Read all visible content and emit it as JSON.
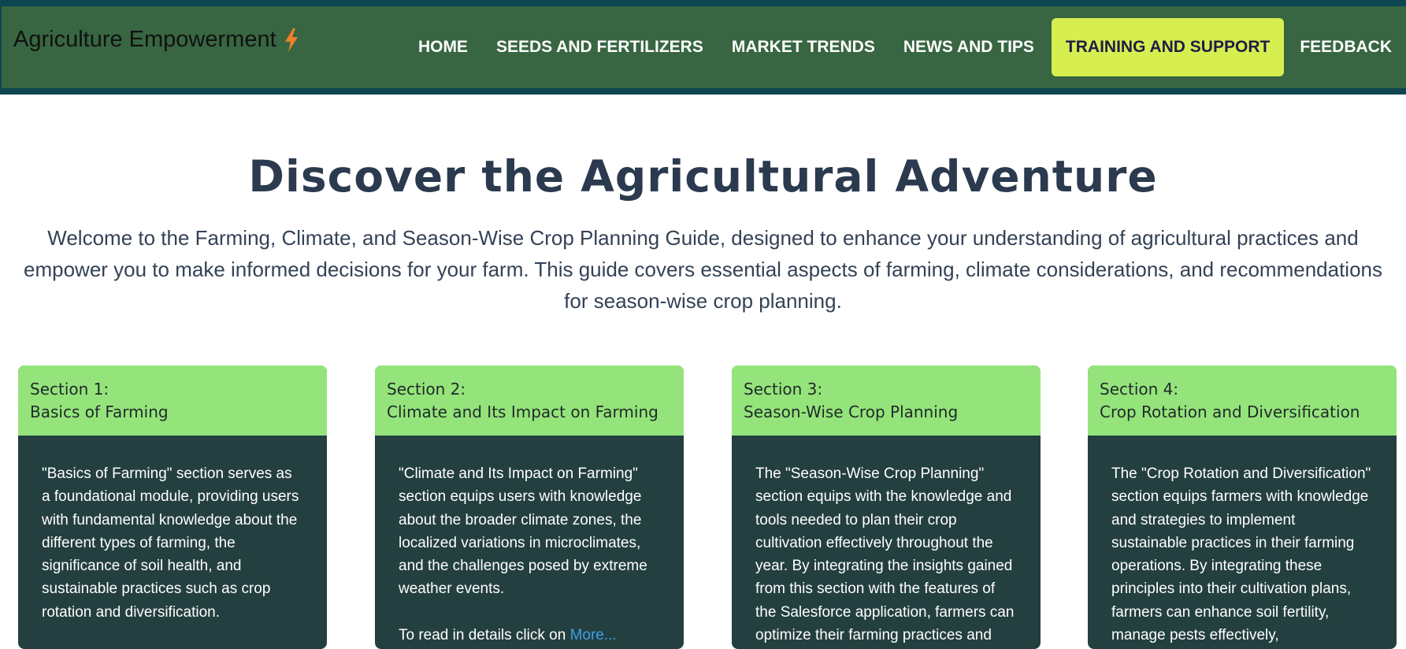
{
  "header": {
    "brand": "Agriculture Empowerment",
    "nav": [
      {
        "label": "HOME"
      },
      {
        "label": "SEEDS AND FERTILIZERS"
      },
      {
        "label": "MARKET TRENDS"
      },
      {
        "label": "NEWS AND TIPS"
      },
      {
        "label": "TRAINING AND SUPPORT",
        "active": true
      },
      {
        "label": "FEEDBACK"
      }
    ]
  },
  "hero": {
    "title": "Discover the Agricultural Adventure",
    "intro": "Welcome to the Farming, Climate, and Season-Wise Crop Planning Guide, designed to enhance your understanding of agricultural practices and empower you to make informed decisions for your farm. This guide covers essential aspects of farming, climate considerations, and recommendations for season-wise crop planning."
  },
  "sections": [
    {
      "number": "Section 1:",
      "title": "Basics of Farming",
      "body": "\"Basics of Farming\" section serves as a foundational module, providing users with fundamental knowledge about the different types of farming, the significance of soil health, and sustainable practices such as crop rotation and diversification."
    },
    {
      "number": "Section 2:",
      "title": "Climate and Its Impact on Farming",
      "body": "\"Climate and Its Impact on Farming\" section equips users with knowledge about the broader climate zones, the localized variations in microclimates, and the challenges posed by extreme weather events.",
      "read_prefix": "To read in details click on ",
      "read_link": "More..."
    },
    {
      "number": "Section 3:",
      "title": "Season-Wise Crop Planning",
      "body": "The \"Season-Wise Crop Planning\" section equips with the knowledge and tools needed to plan their crop cultivation effectively throughout the year. By integrating the insights gained from this section with the features of the Salesforce application, farmers can optimize their farming practices and"
    },
    {
      "number": "Section 4:",
      "title": "Crop Rotation and Diversification",
      "body": "The \"Crop Rotation and Diversification\" section equips farmers with knowledge and strategies to implement sustainable practices in their farming operations. By integrating these principles into their cultivation plans, farmers can enhance soil fertility, manage pests effectively,"
    }
  ],
  "icons": {
    "brand_icon": "lightning-bolt-icon"
  },
  "colors": {
    "top_border": "#0e4552",
    "nav_bg": "#386642",
    "active_tab": "#d6ee50",
    "card_head": "#95e47b",
    "card_body": "#243f3f",
    "link": "#3aa0e8"
  }
}
